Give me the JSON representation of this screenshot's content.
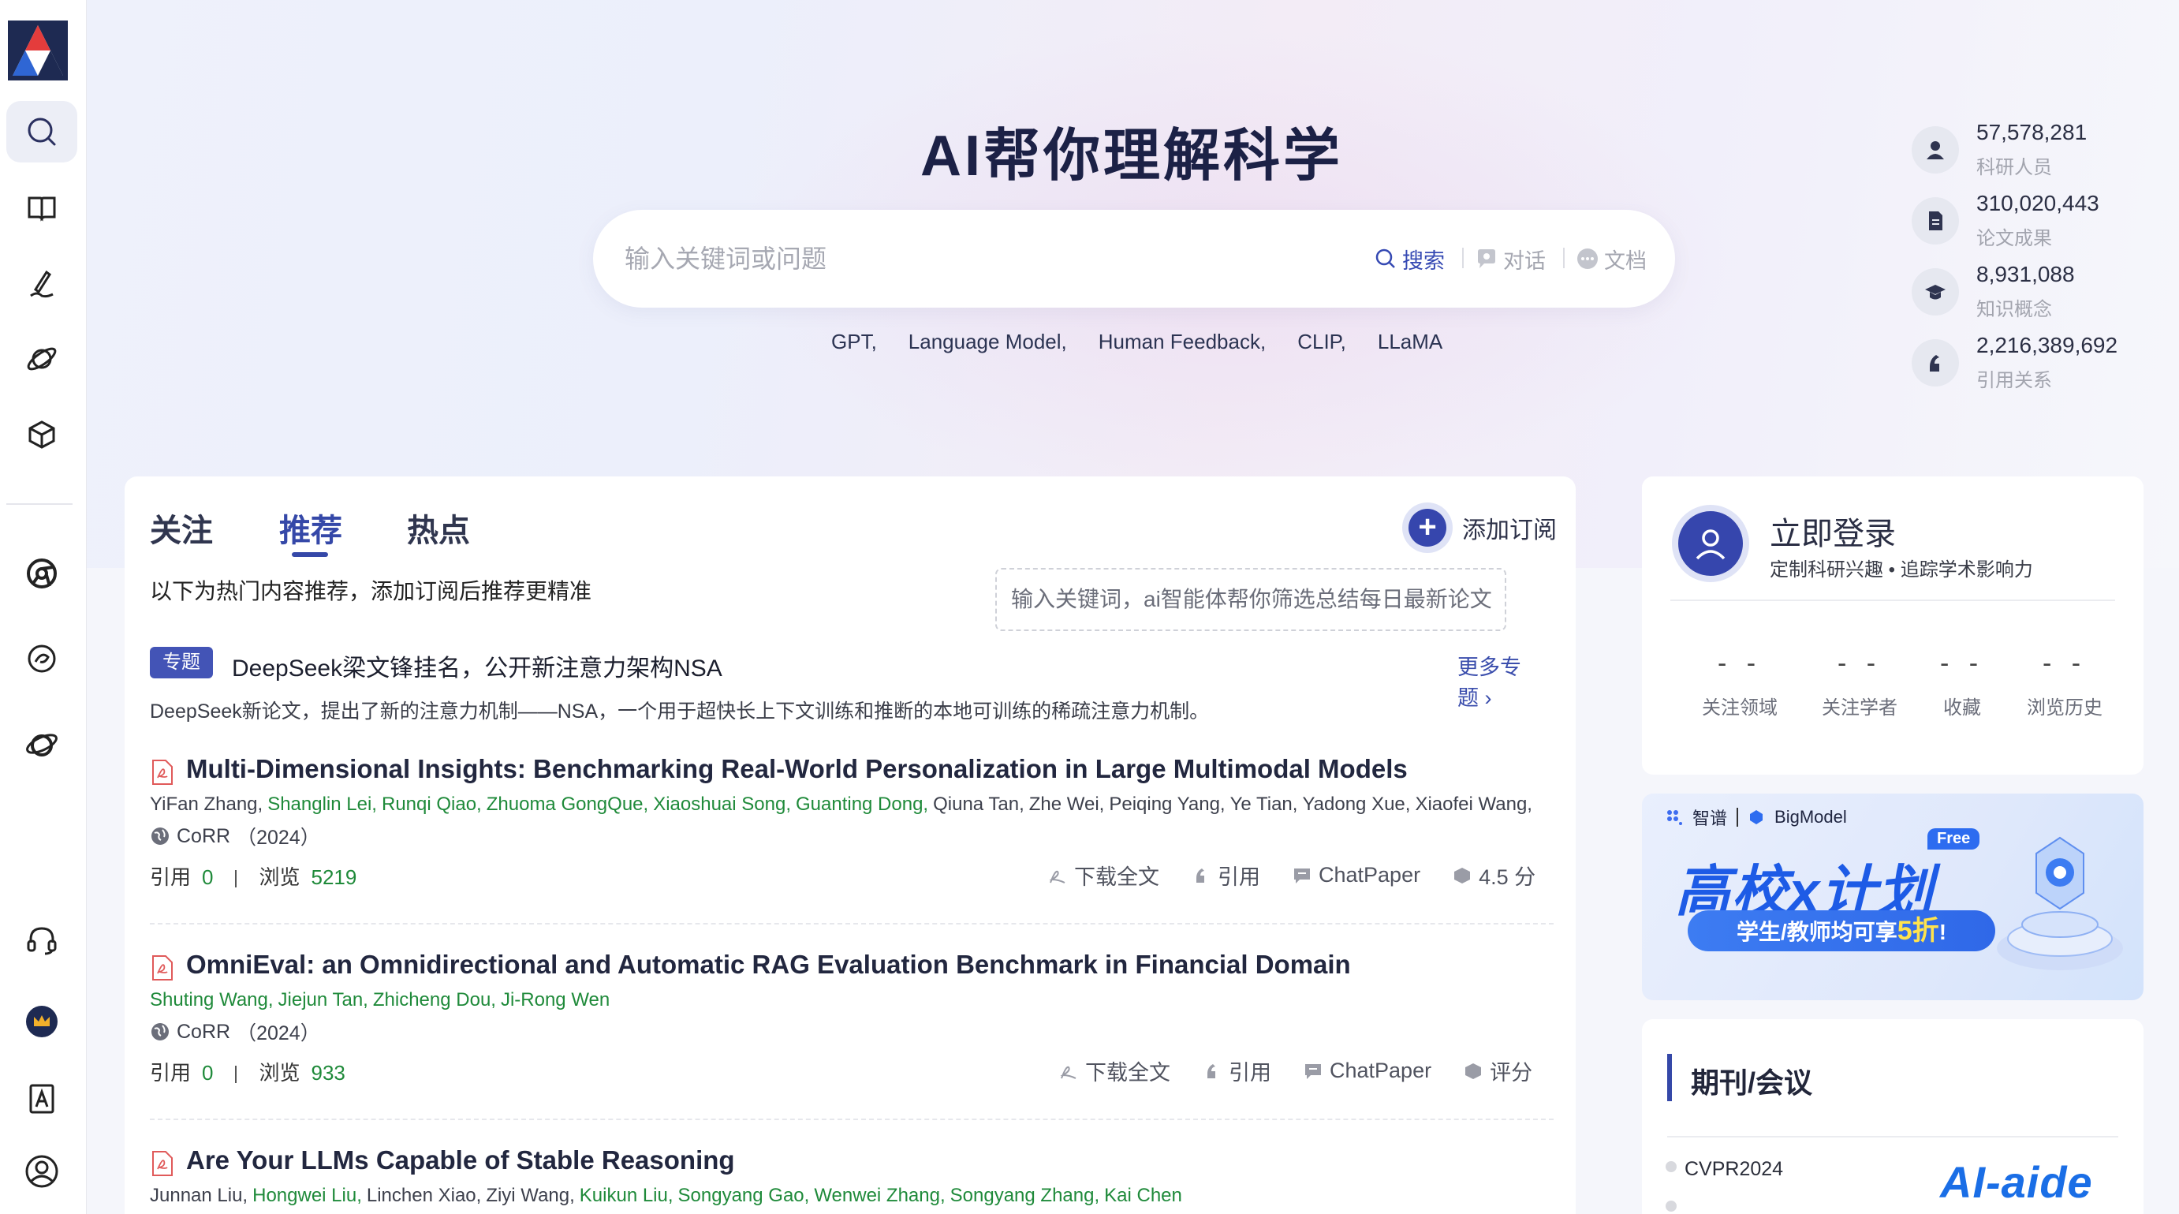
{
  "hero": {
    "title": "AI帮你理解科学",
    "search_placeholder": "输入关键词或问题",
    "modes": [
      "搜索",
      "对话",
      "文档"
    ],
    "tags": [
      "GPT,",
      "Language Model,",
      "Human Feedback,",
      "CLIP,",
      "LLaMA"
    ]
  },
  "stats": [
    {
      "value": "57,578,281",
      "label": "科研人员"
    },
    {
      "value": "310,020,443",
      "label": "论文成果"
    },
    {
      "value": "8,931,088",
      "label": "知识概念"
    },
    {
      "value": "2,216,389,692",
      "label": "引用关系"
    }
  ],
  "feed": {
    "tabs": [
      "关注",
      "推荐",
      "热点"
    ],
    "active_tab": "推荐",
    "add_subscription": "添加订阅",
    "subscription_tip": "输入关键词，ai智能体帮你筛选总结每日最新论文",
    "hint": "以下为热门内容推荐，添加订阅后推荐更精准",
    "topic": {
      "badge": "专题",
      "title": "DeepSeek梁文锋挂名，公开新注意力架构NSA",
      "more": "更多专题",
      "description": "DeepSeek新论文，提出了新的注意力机制——NSA，一个用于超快长上下文训练和推断的本地可训练的稀疏注意力机制。"
    },
    "papers": [
      {
        "title": "Multi-Dimensional Insights: Benchmarking Real-World Personalization in Large Multimodal Models",
        "authors": [
          {
            "name": "YiFan Zhang,",
            "highlight": false
          },
          {
            "name": "Shanglin Lei,",
            "highlight": true
          },
          {
            "name": "Runqi Qiao,",
            "highlight": true
          },
          {
            "name": "Zhuoma GongQue,",
            "highlight": true
          },
          {
            "name": "Xiaoshuai Song,",
            "highlight": true
          },
          {
            "name": "Guanting Dong,",
            "highlight": true
          },
          {
            "name": "Qiuna Tan,",
            "highlight": false
          },
          {
            "name": "Zhe Wei,",
            "highlight": false
          },
          {
            "name": "Peiqing Yang,",
            "highlight": false
          },
          {
            "name": "Ye Tian,",
            "highlight": false
          },
          {
            "name": "Yadong Xue,",
            "highlight": false
          },
          {
            "name": "Xiaofei Wang,",
            "highlight": false
          }
        ],
        "venue": "CoRR",
        "year": "（2024）",
        "cite_label": "引用",
        "cite_count": "0",
        "view_label": "浏览",
        "view_count": "5219",
        "actions": [
          "下载全文",
          "引用",
          "ChatPaper",
          "4.5 分"
        ]
      },
      {
        "title": "OmniEval: an Omnidirectional and Automatic RAG Evaluation Benchmark in Financial Domain",
        "authors": [
          {
            "name": "Shuting Wang,",
            "highlight": true
          },
          {
            "name": "Jiejun Tan,",
            "highlight": true
          },
          {
            "name": "Zhicheng Dou,",
            "highlight": true
          },
          {
            "name": "Ji-Rong Wen",
            "highlight": true
          }
        ],
        "venue": "CoRR",
        "year": "（2024）",
        "cite_label": "引用",
        "cite_count": "0",
        "view_label": "浏览",
        "view_count": "933",
        "actions": [
          "下载全文",
          "引用",
          "ChatPaper",
          "评分"
        ]
      },
      {
        "title": "Are Your LLMs Capable of Stable Reasoning",
        "authors": [
          {
            "name": "Junnan Liu,",
            "highlight": false
          },
          {
            "name": "Hongwei Liu,",
            "highlight": true
          },
          {
            "name": "Linchen Xiao,",
            "highlight": false
          },
          {
            "name": "Ziyi Wang,",
            "highlight": false
          },
          {
            "name": "Kuikun Liu,",
            "highlight": true
          },
          {
            "name": "Songyang Gao,",
            "highlight": true
          },
          {
            "name": "Wenwei Zhang,",
            "highlight": true
          },
          {
            "name": "Songyang Zhang,",
            "highlight": true
          },
          {
            "name": "Kai Chen",
            "highlight": true
          }
        ]
      }
    ]
  },
  "login": {
    "title": "立即登录",
    "subtitle": "定制科研兴趣 • 追踪学术影响力",
    "metrics": [
      {
        "value": "- -",
        "label": "关注领域"
      },
      {
        "value": "- -",
        "label": "关注学者"
      },
      {
        "value": "- -",
        "label": "收藏"
      },
      {
        "value": "- -",
        "label": "浏览历史"
      }
    ]
  },
  "banner": {
    "brand1": "智谱",
    "brand2": "BigModel",
    "headline": "高校x计划",
    "free": "Free",
    "pill_prefix": "学生/教师均可享",
    "pill_highlight": "5折",
    "pill_suffix": "!"
  },
  "journals": {
    "title": "期刊/会议",
    "items": [
      "CVPR2024"
    ]
  },
  "watermark": "AI-aide",
  "colors": {
    "accent": "#3548a8",
    "author_highlight": "#1f8a3a",
    "banner_blue": "#1d5be6"
  }
}
